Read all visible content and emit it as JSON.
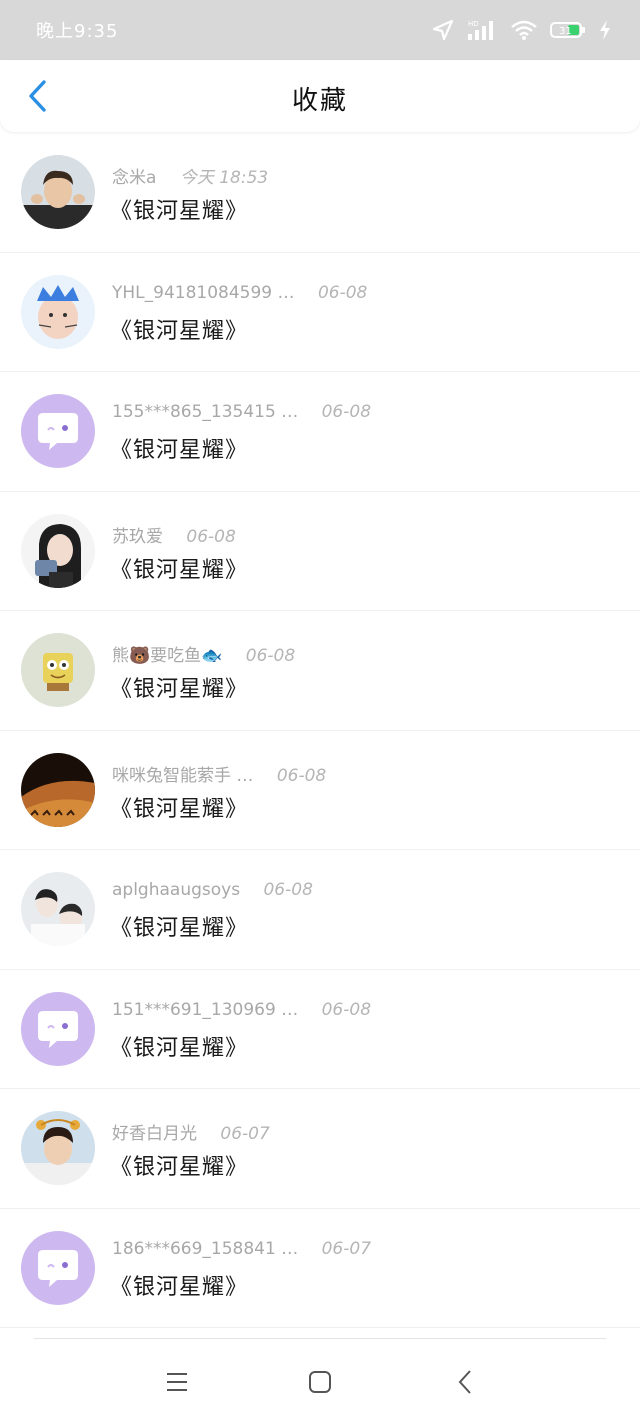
{
  "status_bar": {
    "time": "晚上9:35",
    "battery": "31",
    "network": "HD"
  },
  "header": {
    "title": "收藏"
  },
  "favorites": [
    {
      "name": "念米a",
      "date": "今天 18:53",
      "title": "《银河星耀》",
      "avatar": "photo-boy"
    },
    {
      "name": "YHL_94181084599 …",
      "date": "06-08",
      "title": "《银河星耀》",
      "avatar": "photo-child"
    },
    {
      "name": "155***865_135415 …",
      "date": "06-08",
      "title": "《银河星耀》",
      "avatar": "default-chat"
    },
    {
      "name": "苏玖爱",
      "date": "06-08",
      "title": "《银河星耀》",
      "avatar": "photo-girl"
    },
    {
      "name": "熊🐻要吃鱼🐟",
      "date": "06-08",
      "title": "《银河星耀》",
      "avatar": "photo-sponge"
    },
    {
      "name": "咪咪兔智能萦手 …",
      "date": "06-08",
      "title": "《银河星耀》",
      "avatar": "photo-desert"
    },
    {
      "name": "aplghaaugsoys",
      "date": "06-08",
      "title": "《银河星耀》",
      "avatar": "photo-couple"
    },
    {
      "name": "151***691_130969 …",
      "date": "06-08",
      "title": "《银河星耀》",
      "avatar": "default-chat"
    },
    {
      "name": "好香白月光",
      "date": "06-07",
      "title": "《银河星耀》",
      "avatar": "photo-boy2"
    },
    {
      "name": "186***669_158841 …",
      "date": "06-07",
      "title": "《银河星耀》",
      "avatar": "default-chat"
    }
  ],
  "colors": {
    "accent": "#2b8fe3",
    "default_avatar_bg": "#cdb8f0",
    "status_bar_bg": "#d8d8d8"
  },
  "bottom_nav": [
    "menu-icon",
    "home-square-icon",
    "back-chevron-icon"
  ]
}
